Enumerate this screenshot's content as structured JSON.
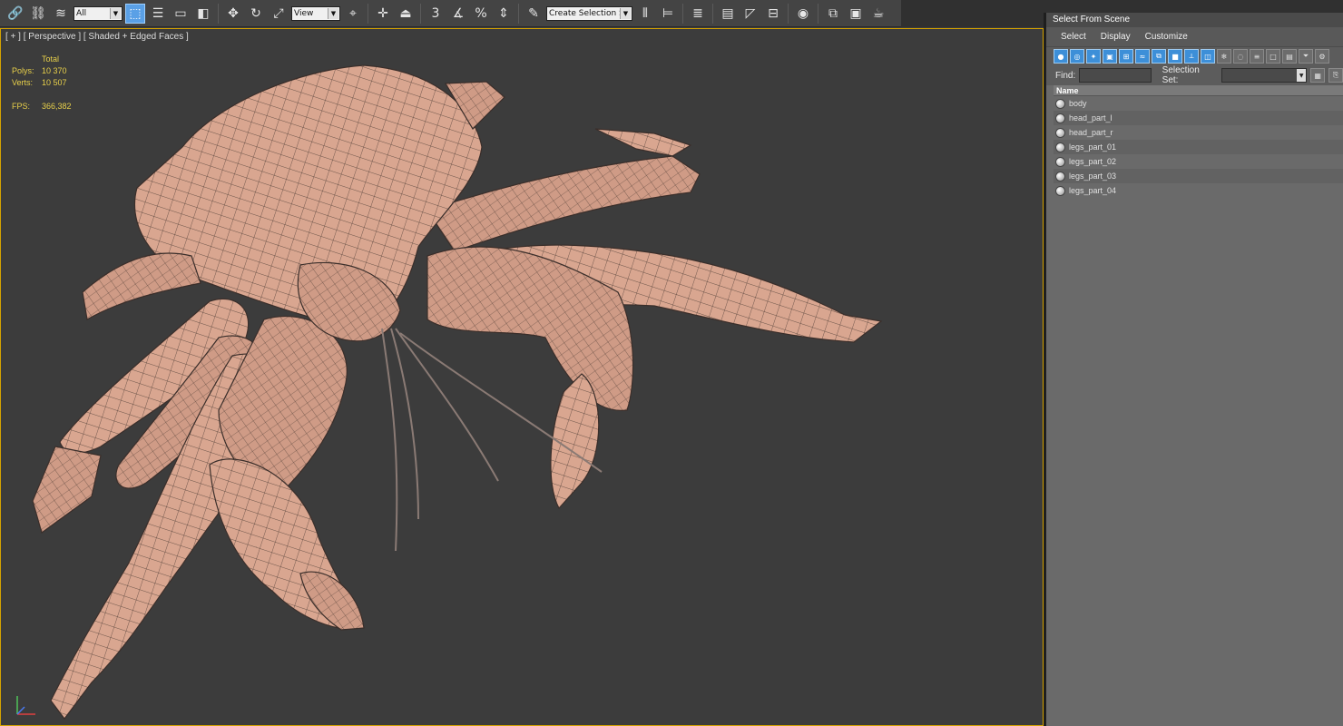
{
  "toolbar": {
    "filter_value": "All",
    "ref_coord_value": "View",
    "selection_set_placeholder": "Create Selection Se",
    "snap_angle_label": "3",
    "percent_snap_label": "%"
  },
  "viewport": {
    "label": "[ + ] [ Perspective ] [ Shaded + Edged Faces ]",
    "stats": {
      "total_label": "Total",
      "polys_label": "Polys:",
      "polys_value": "10 370",
      "verts_label": "Verts:",
      "verts_value": "10 507",
      "fps_label": "FPS:",
      "fps_value": "366,382"
    },
    "mesh_color": "#d9a690",
    "edge_color": "#3a2e2a"
  },
  "panel": {
    "title": "Select From Scene",
    "menu": [
      "Select",
      "Display",
      "Customize"
    ],
    "find_label": "Find:",
    "selection_set_label": "Selection Set:",
    "column_header": "Name",
    "objects": [
      "body",
      "head_part_l",
      "head_part_r",
      "legs_part_01",
      "legs_part_02",
      "legs_part_03",
      "legs_part_04"
    ]
  },
  "colors": {
    "viewport_bg": "#3c3c3c",
    "active_border": "#d4a200",
    "stats_text": "#e8d04a",
    "accent": "#3d8fd8"
  }
}
